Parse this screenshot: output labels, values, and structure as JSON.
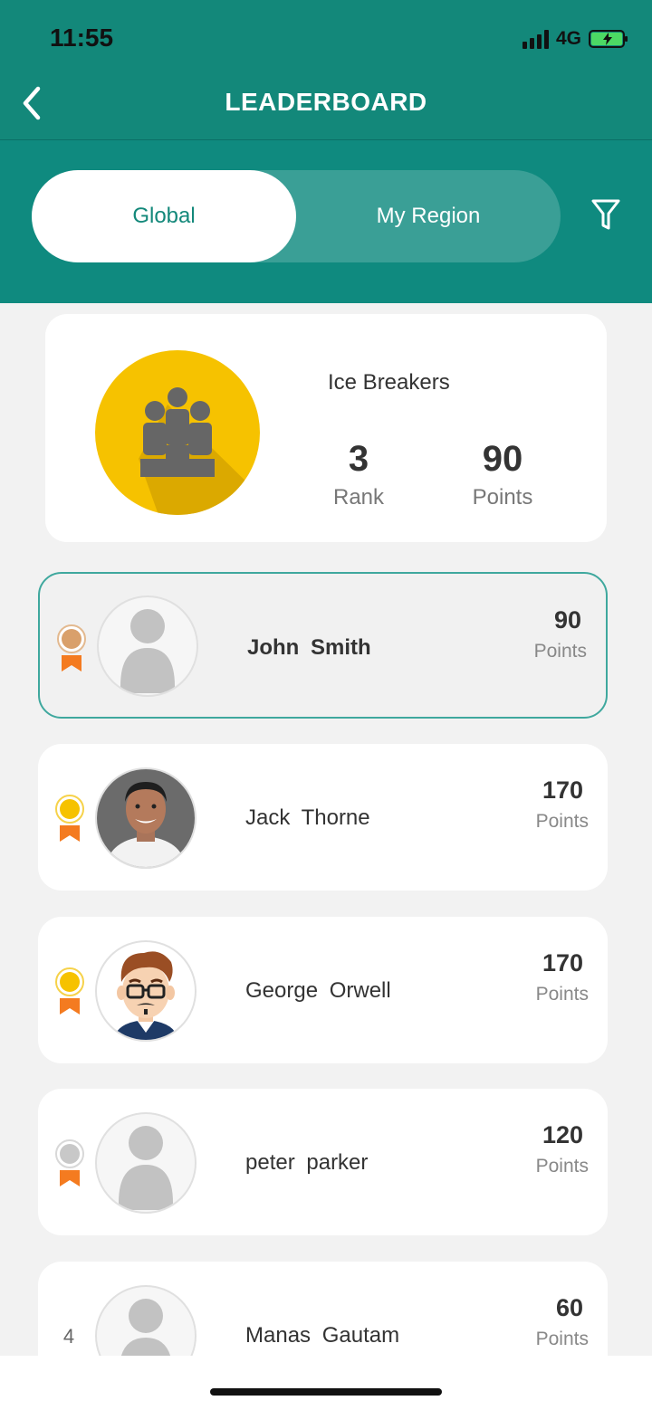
{
  "status_bar": {
    "time": "11:55",
    "network": "4G"
  },
  "header": {
    "title": "LEADERBOARD"
  },
  "tabs": {
    "global": "Global",
    "region": "My Region",
    "active": "Global"
  },
  "team": {
    "name": "Ice Breakers",
    "rank": "3",
    "rank_label": "Rank",
    "points": "90",
    "points_label": "Points"
  },
  "leaderboard": [
    {
      "name": "John  Smith",
      "points": "90",
      "points_label": "Points",
      "medal": "bronze",
      "avatar": "placeholder",
      "highlighted": true
    },
    {
      "name": "Jack  Thorne",
      "points": "170",
      "points_label": "Points",
      "medal": "gold",
      "avatar": "photo"
    },
    {
      "name": "George  Orwell",
      "points": "170",
      "points_label": "Points",
      "medal": "gold",
      "avatar": "cartoon"
    },
    {
      "name": "peter  parker",
      "points": "120",
      "points_label": "Points",
      "medal": "silver",
      "avatar": "placeholder"
    },
    {
      "name": "Manas  Gautam",
      "points": "60",
      "points_label": "Points",
      "rank": "4",
      "avatar": "placeholder"
    }
  ],
  "colors": {
    "teal": "#13887a",
    "gold": "#f6c200",
    "silver": "#c8c8c8",
    "bronze": "#d9a06b",
    "ribbon": "#f47b20"
  }
}
